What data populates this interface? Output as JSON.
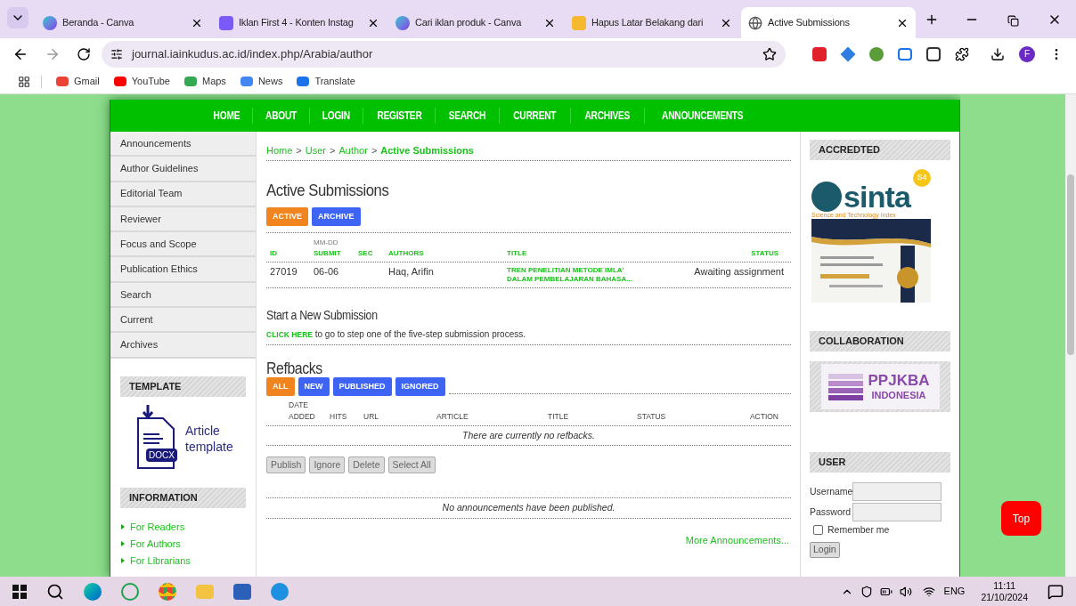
{
  "browser": {
    "tabs": [
      {
        "title": "Beranda - Canva",
        "selected": false
      },
      {
        "title": "Iklan First 4 - Konten Instag",
        "selected": false
      },
      {
        "title": "Cari iklan produk - Canva",
        "selected": false
      },
      {
        "title": "Hapus Latar Belakang dari",
        "selected": false
      },
      {
        "title": "Active Submissions",
        "selected": true
      }
    ],
    "url": "journal.iainkudus.ac.id/index.php/Arabia/author",
    "profile": "F",
    "bookmarks": [
      {
        "label": "Gmail"
      },
      {
        "label": "YouTube"
      },
      {
        "label": "Maps"
      },
      {
        "label": "News"
      },
      {
        "label": "Translate"
      }
    ]
  },
  "nav": [
    "HOME",
    "ABOUT",
    "LOGIN",
    "REGISTER",
    "SEARCH",
    "CURRENT",
    "ARCHIVES",
    "ANNOUNCEMENTS"
  ],
  "sidebar": {
    "links": [
      "Announcements",
      "Author Guidelines",
      "Editorial Team",
      "Reviewer",
      "Focus and Scope",
      "Publication Ethics",
      "Search",
      "Current",
      "Archives"
    ],
    "template": {
      "title": "TEMPLATE",
      "badge": "DOCX",
      "caption": "Article template"
    },
    "information": {
      "title": "INFORMATION",
      "links": [
        "For Readers",
        "For Authors",
        "For Librarians"
      ]
    }
  },
  "breadcrumb_separator": ">",
  "breadcrumb": [
    {
      "label": "Home",
      "current": false
    },
    {
      "label": "User",
      "current": false
    },
    {
      "label": "Author",
      "current": false
    },
    {
      "label": "Active Submissions",
      "current": true
    }
  ],
  "heading": "Active Submissions",
  "submission_tabs": [
    {
      "label": "ACTIVE",
      "selected": true
    },
    {
      "label": "ARCHIVE",
      "selected": false
    }
  ],
  "submissions": {
    "columns": [
      {
        "label": "ID"
      },
      {
        "over": "MM-DD",
        "label": "SUBMIT"
      },
      {
        "label": "SEC"
      },
      {
        "label": "AUTHORS"
      },
      {
        "label": "TITLE"
      },
      {
        "label": "STATUS"
      }
    ],
    "rows": [
      {
        "cells": [
          {
            "kind": "plain",
            "lines": [
              "27019"
            ]
          },
          {
            "kind": "plain",
            "lines": [
              "06-06"
            ]
          },
          {
            "kind": "empty"
          },
          {
            "kind": "plain",
            "lines": [
              "Haq, Arifin"
            ]
          },
          {
            "kind": "link",
            "lines": [
              "TREN PENELITIAN METODE IMLA’",
              "DALAM PEMBELAJARAN BAHASA..."
            ]
          },
          {
            "kind": "plain",
            "lines": [
              "Awaiting assignment"
            ]
          }
        ]
      }
    ]
  },
  "new_submission": {
    "heading": "Start a New Submission",
    "link": "CLICK HERE",
    "text": "to go to step one of the five-step submission process."
  },
  "refbacks": {
    "heading": "Refbacks",
    "filters": [
      {
        "label": "ALL",
        "selected": true
      },
      {
        "label": "NEW",
        "selected": false
      },
      {
        "label": "PUBLISHED",
        "selected": false
      },
      {
        "label": "IGNORED",
        "selected": false
      }
    ],
    "columns": [
      {
        "over": "DATE",
        "label": "ADDED"
      },
      {
        "label": "HITS"
      },
      {
        "label": "URL"
      },
      {
        "label": "ARTICLE"
      },
      {
        "label": "TITLE"
      },
      {
        "label": "STATUS"
      },
      {
        "label": "ACTION"
      }
    ],
    "empty": "There are currently no refbacks.",
    "buttons": [
      "Publish",
      "Ignore",
      "Delete",
      "Select All"
    ]
  },
  "announcements": {
    "empty": "No announcements have been published.",
    "more": "More Announcements..."
  },
  "right": {
    "accredited": {
      "title": "ACCREDTED",
      "logo": "sinta",
      "grade": "S4",
      "tagline": "Science and Technology Index"
    },
    "collaboration": {
      "title": "COLLABORATION",
      "logo_lines": [
        "PPJKBA",
        "INDONESIA"
      ]
    },
    "user": {
      "title": "USER",
      "username": "Username",
      "password": "Password",
      "remember": "Remember me",
      "remember_checked": false,
      "login": "Login"
    }
  },
  "top_button": "Top",
  "taskbar": {
    "language": "ENG",
    "time": "11:11",
    "date": "21/10/2024"
  }
}
